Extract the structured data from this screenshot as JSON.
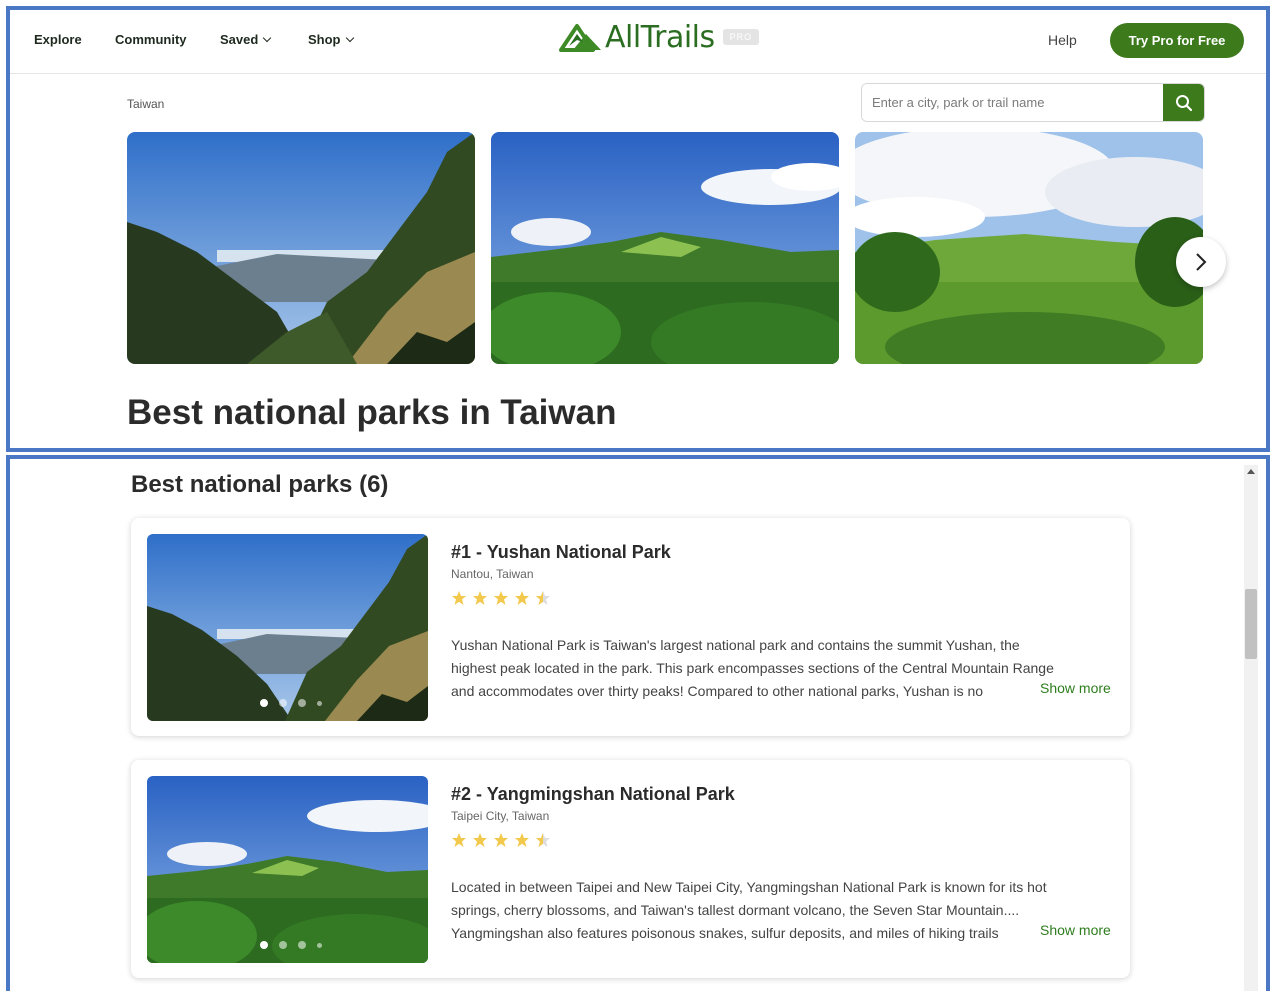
{
  "nav": {
    "explore": "Explore",
    "community": "Community",
    "saved": "Saved",
    "shop": "Shop",
    "logo_text": "AllTrails",
    "pro_badge": "PRO",
    "help": "Help",
    "try_pro": "Try Pro for Free"
  },
  "breadcrumb": "Taiwan",
  "search": {
    "placeholder": "Enter a city, park or trail name"
  },
  "page_title": "Best national parks in Taiwan",
  "section_title": "Best national parks (6)",
  "colors": {
    "brand_green": "#3d7a1c",
    "star_gold": "#f2c94c",
    "accent_blue_border": "#4a78c4"
  },
  "parks": [
    {
      "title": "#1 - Yushan National Park",
      "location": "Nantou, Taiwan",
      "rating": 4.5,
      "desc_lines": [
        "Yushan National Park is Taiwan's largest national park and contains the summit Yushan, the",
        "highest peak located in the park. This park encompasses sections of the Central Mountain Range",
        "and accommodates over thirty peaks! Compared to other national parks, Yushan is no"
      ],
      "show_more": "Show more"
    },
    {
      "title": "#2 - Yangmingshan National Park",
      "location": "Taipei City, Taiwan",
      "rating": 4.5,
      "desc_lines": [
        "Located in between Taipei and New Taipei City, Yangmingshan National Park is known for its hot",
        "springs, cherry blossoms, and Taiwan's tallest dormant volcano, the Seven Star Mountain....",
        "Yangmingshan also features poisonous snakes, sulfur deposits, and miles of hiking trails"
      ],
      "show_more": "Show more"
    }
  ]
}
